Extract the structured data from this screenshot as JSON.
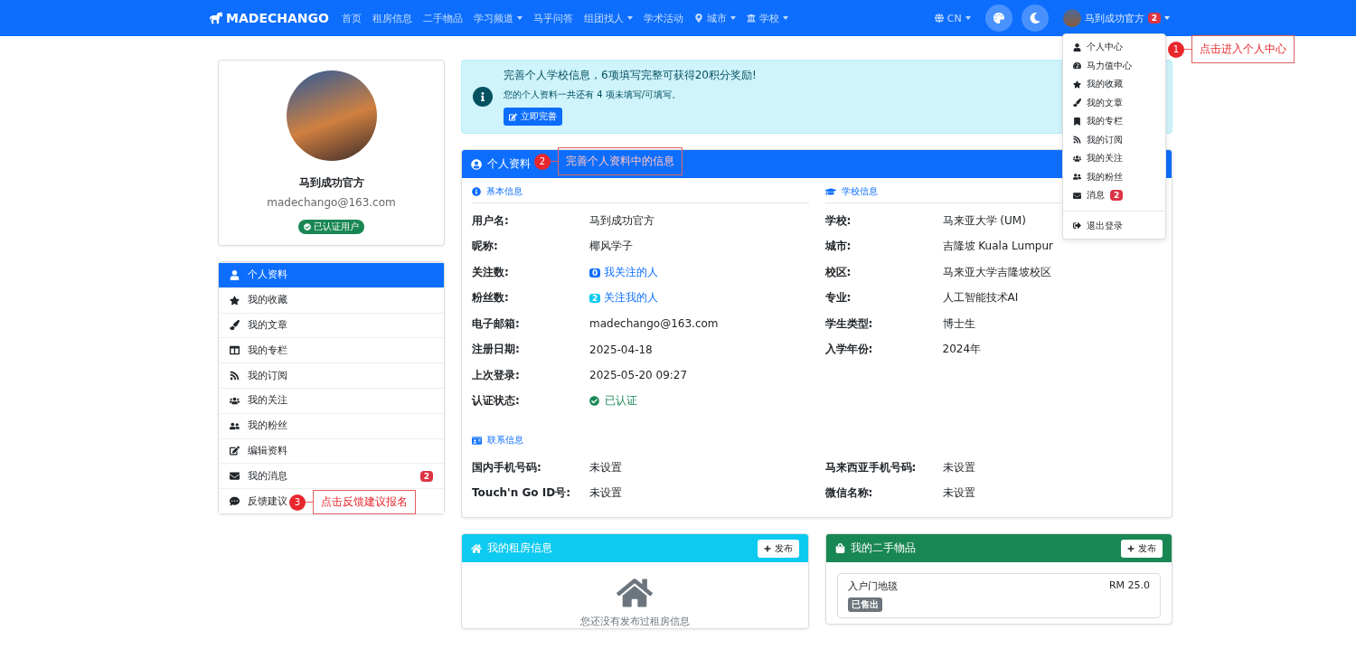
{
  "navbar": {
    "brand": "MADECHANGO",
    "links": [
      {
        "label": "首页",
        "dropdown": false
      },
      {
        "label": "租房信息",
        "dropdown": false
      },
      {
        "label": "二手物品",
        "dropdown": false
      },
      {
        "label": "学习频道",
        "dropdown": true
      },
      {
        "label": "马乎问答",
        "dropdown": false
      },
      {
        "label": "组团找人",
        "dropdown": true
      },
      {
        "label": "学术活动",
        "dropdown": false
      },
      {
        "label": "城市",
        "dropdown": true
      },
      {
        "label": "学校",
        "dropdown": true
      }
    ],
    "language": "CN",
    "user": "马到成功官方",
    "user_badge": "2"
  },
  "user_menu": {
    "items": [
      {
        "label": "个人中心"
      },
      {
        "label": "马力值中心"
      },
      {
        "label": "我的收藏"
      },
      {
        "label": "我的文章"
      },
      {
        "label": "我的专栏"
      },
      {
        "label": "我的订阅"
      },
      {
        "label": "我的关注"
      },
      {
        "label": "我的粉丝"
      },
      {
        "label": "消息",
        "badge": "2"
      }
    ],
    "logout": "退出登录"
  },
  "callouts": [
    {
      "number": "1",
      "text": "点击进入个人中心"
    },
    {
      "number": "2",
      "text": "完善个人资料中的信息"
    },
    {
      "number": "3",
      "text": "点击反馈建议报名"
    }
  ],
  "profile_card": {
    "name": "马到成功官方",
    "email": "madechango@163.com",
    "badge": "已认证用户"
  },
  "sidebar": {
    "items": [
      {
        "label": "个人资料",
        "selected": true
      },
      {
        "label": "我的收藏",
        "selected": false
      },
      {
        "label": "我的文章",
        "selected": false
      },
      {
        "label": "我的专栏",
        "selected": false
      },
      {
        "label": "我的订阅",
        "selected": false
      },
      {
        "label": "我的关注",
        "selected": false
      },
      {
        "label": "我的粉丝",
        "selected": false
      },
      {
        "label": "编辑资料",
        "selected": false
      },
      {
        "label": "我的消息",
        "selected": false,
        "badge": "2"
      },
      {
        "label": "反馈建议",
        "selected": false
      }
    ]
  },
  "alert": {
    "title": "完善个人学校信息，6项填写完整可获得20积分奖励!",
    "text": "您的个人资料一共还有 4 项未填写/可填写。",
    "button": "立即完善"
  },
  "profile_panel": {
    "title": "个人资料",
    "basic": {
      "heading": "基本信息",
      "rows": [
        {
          "label": "用户名:",
          "value": "马到成功官方",
          "kind": "text"
        },
        {
          "label": "昵称:",
          "value": "椰风学子",
          "kind": "text"
        },
        {
          "label": "关注数:",
          "value": "我关注的人",
          "kind": "link",
          "count": "0"
        },
        {
          "label": "粉丝数:",
          "value": "关注我的人",
          "kind": "link",
          "count": "2"
        },
        {
          "label": "电子邮箱:",
          "value": "madechango@163.com",
          "kind": "text"
        },
        {
          "label": "注册日期:",
          "value": "2025-04-18",
          "kind": "text"
        },
        {
          "label": "上次登录:",
          "value": "2025-05-20 09:27",
          "kind": "text"
        },
        {
          "label": "认证状态:",
          "value": "已认证",
          "kind": "verified"
        }
      ]
    },
    "school": {
      "heading": "学校信息",
      "rows": [
        {
          "label": "学校:",
          "value": "马来亚大学 (UM)"
        },
        {
          "label": "城市:",
          "value": "吉隆坡 Kuala Lumpur"
        },
        {
          "label": "校区:",
          "value": "马来亚大学吉隆坡校区"
        },
        {
          "label": "专业:",
          "value": "人工智能技术AI"
        },
        {
          "label": "学生类型:",
          "value": "博士生"
        },
        {
          "label": "入学年份:",
          "value": "2024年"
        }
      ]
    },
    "contact": {
      "heading": "联系信息",
      "rows": [
        {
          "label": "国内手机号码:",
          "value": "未设置"
        },
        {
          "label": "马来西亚手机号码:",
          "value": "未设置"
        },
        {
          "label": "Touch'n Go ID号:",
          "value": "未设置"
        },
        {
          "label": "微信名称:",
          "value": "未设置"
        }
      ]
    }
  },
  "rental_panel": {
    "title": "我的租房信息",
    "button": "发布",
    "empty": "您还没有发布过租房信息"
  },
  "secondhand_panel": {
    "title": "我的二手物品",
    "button": "发布",
    "items": [
      {
        "name": "入户门地毯",
        "price": "RM 25.0",
        "status": "已售出"
      }
    ]
  }
}
